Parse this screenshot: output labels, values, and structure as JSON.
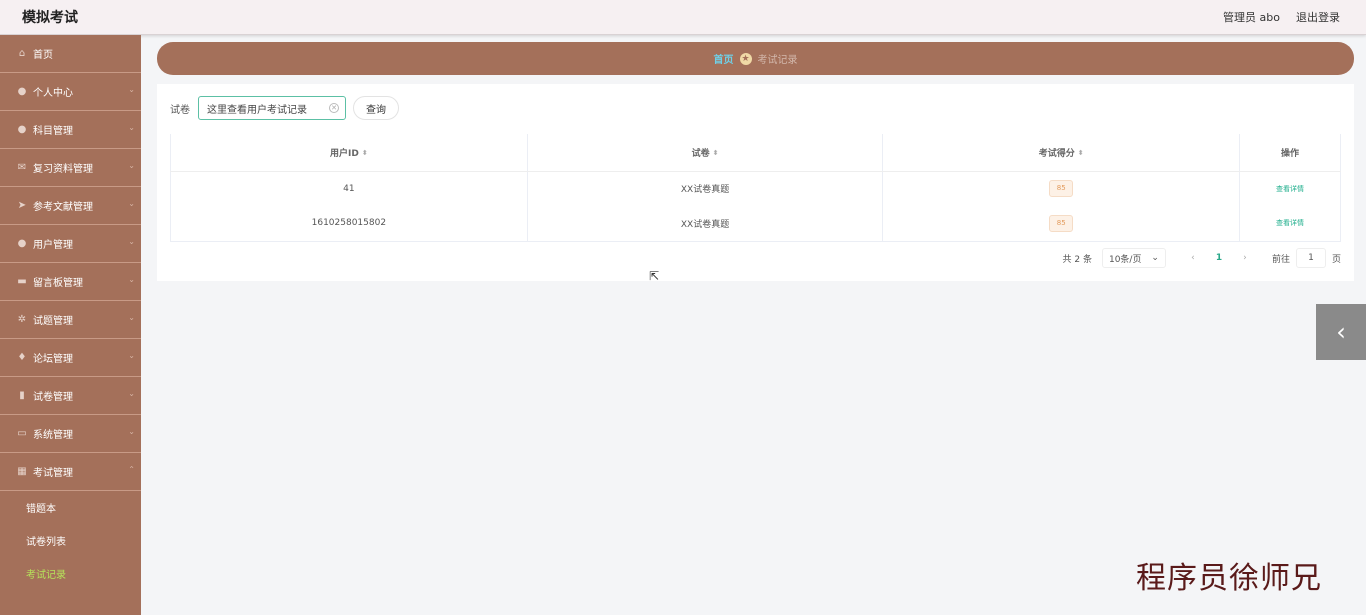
{
  "header": {
    "title": "模拟考试",
    "user_label": "管理员 abo",
    "logout_label": "退出登录"
  },
  "sidebar": {
    "items": [
      {
        "label": "首页",
        "icon": "home-icon",
        "glyph": "⌂"
      },
      {
        "label": "个人中心",
        "icon": "user-icon",
        "glyph": "●"
      },
      {
        "label": "科目管理",
        "icon": "user-icon",
        "glyph": "●"
      },
      {
        "label": "复习资料管理",
        "icon": "mail-icon",
        "glyph": "✉"
      },
      {
        "label": "参考文献管理",
        "icon": "send-icon",
        "glyph": "➤"
      },
      {
        "label": "用户管理",
        "icon": "user-icon",
        "glyph": "●"
      },
      {
        "label": "留言板管理",
        "icon": "message-icon",
        "glyph": "▬"
      },
      {
        "label": "试题管理",
        "icon": "gear-icon",
        "glyph": "✲"
      },
      {
        "label": "论坛管理",
        "icon": "pin-icon",
        "glyph": "♦"
      },
      {
        "label": "试卷管理",
        "icon": "document-icon",
        "glyph": "▮"
      },
      {
        "label": "系统管理",
        "icon": "briefcase-icon",
        "glyph": "▭"
      },
      {
        "label": "考试管理",
        "icon": "grid-icon",
        "glyph": "▦"
      }
    ],
    "sub_items": [
      {
        "label": "错题本",
        "active": false
      },
      {
        "label": "试卷列表",
        "active": false
      },
      {
        "label": "考试记录",
        "active": true
      }
    ],
    "active_color": "#b6e35a"
  },
  "breadcrumb": {
    "home": "首页",
    "current": "考试记录"
  },
  "search": {
    "label": "试卷",
    "value": "这里查看用户考试记录",
    "button": "查询"
  },
  "table": {
    "columns": [
      "用户ID",
      "试卷",
      "考试得分",
      "操作"
    ],
    "rows": [
      {
        "user_id": "41",
        "paper": "XX试卷真题",
        "score": "85",
        "action": "查看详情"
      },
      {
        "user_id": "1610258015802",
        "paper": "XX试卷真题",
        "score": "85",
        "action": "查看详情"
      }
    ]
  },
  "pagination": {
    "total": "共 2 条",
    "page_size": "10条/页",
    "current_page": "1",
    "goto_label": "前往",
    "goto_value": "1",
    "page_unit": "页"
  },
  "watermark": "程序员徐师兄",
  "colors": {
    "sidebar_bg": "#a4705a",
    "accent_green": "#1fae8c",
    "score_tag": "#e39b5c"
  }
}
